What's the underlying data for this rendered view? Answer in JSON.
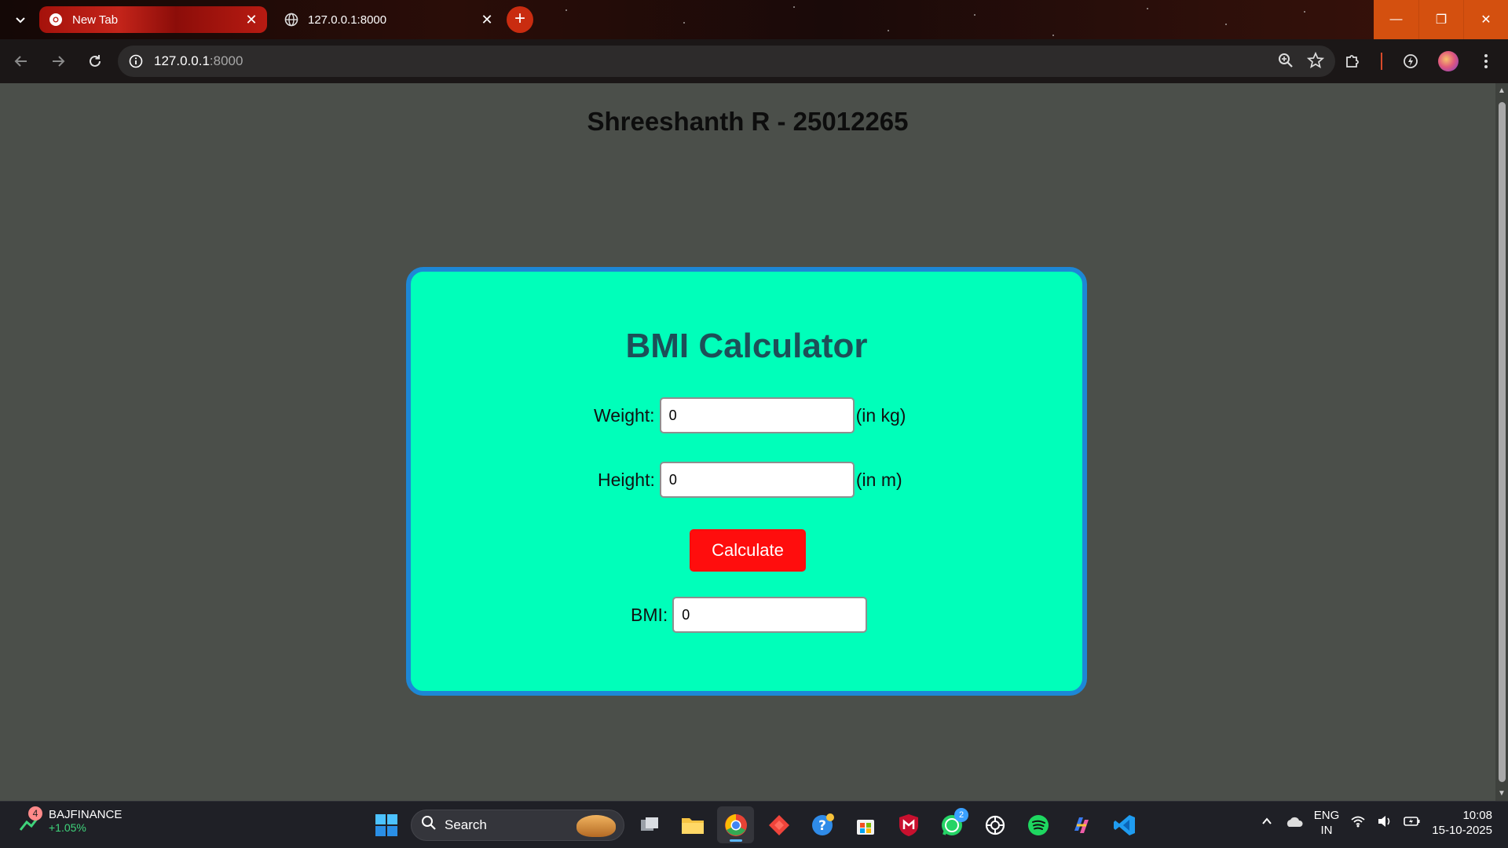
{
  "browser": {
    "tabs": [
      {
        "title": "New Tab",
        "active": true,
        "icon": "chrome-icon"
      },
      {
        "title": "127.0.0.1:8000",
        "active": false,
        "icon": "globe-icon"
      }
    ],
    "address": {
      "host": "127.0.0.1",
      "port": ":8000"
    },
    "window_controls": {
      "minimize": "—",
      "restore": "❐",
      "close": "✕"
    }
  },
  "page": {
    "heading": "Shreeshanth R - 25012265",
    "card_title": "BMI Calculator",
    "weight": {
      "label": "Weight:",
      "value": "0",
      "unit": "(in kg)"
    },
    "height": {
      "label": "Height:",
      "value": "0",
      "unit": "(in m)"
    },
    "calculate_label": "Calculate",
    "bmi": {
      "label": "BMI:",
      "value": "0"
    },
    "colors": {
      "card_bg": "#00ffba",
      "card_border": "#1d87d6",
      "button": "#ff0d0d",
      "title": "#1d4f58"
    }
  },
  "taskbar": {
    "stock": {
      "name": "BAJFINANCE",
      "change": "+1.05%",
      "badge": "4"
    },
    "search_placeholder": "Search",
    "whatsapp_badge": "2",
    "tray": {
      "lang_top": "ENG",
      "lang_bottom": "IN",
      "time": "10:08",
      "date": "15-10-2025"
    }
  }
}
